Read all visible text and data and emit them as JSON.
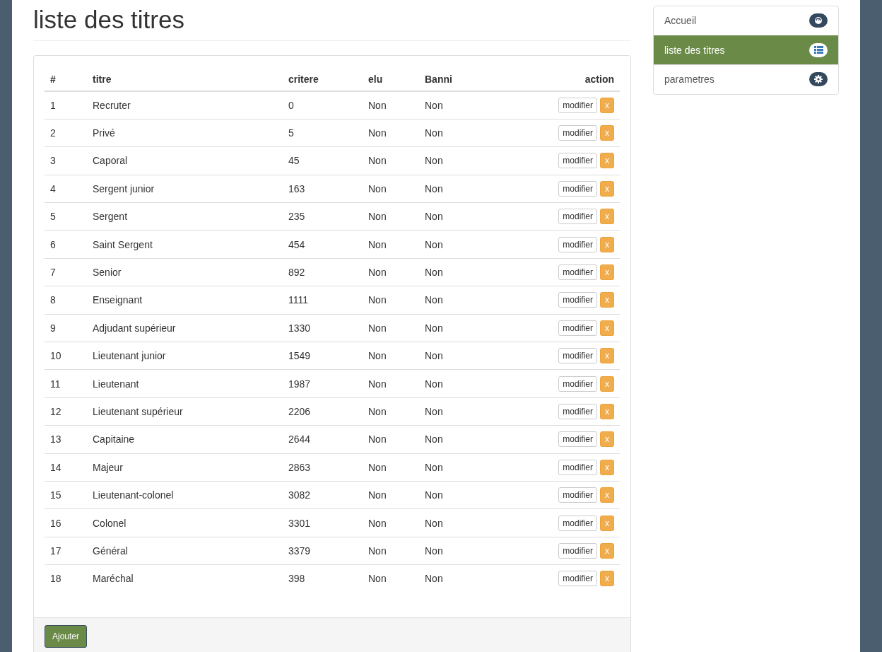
{
  "page_title": "liste des titres",
  "table": {
    "columns": [
      "#",
      "titre",
      "critere",
      "elu",
      "Banni",
      "action"
    ],
    "rows": [
      {
        "cells": [
          "1",
          "Recruter",
          "0",
          "Non",
          "Non"
        ],
        "edit": "modifier",
        "delete": "x"
      },
      {
        "cells": [
          "2",
          "Privé",
          "5",
          "Non",
          "Non"
        ],
        "edit": "modifier",
        "delete": "x"
      },
      {
        "cells": [
          "3",
          "Caporal",
          "45",
          "Non",
          "Non"
        ],
        "edit": "modifier",
        "delete": "x"
      },
      {
        "cells": [
          "4",
          "Sergent junior",
          "163",
          "Non",
          "Non"
        ],
        "edit": "modifier",
        "delete": "x"
      },
      {
        "cells": [
          "5",
          "Sergent",
          "235",
          "Non",
          "Non"
        ],
        "edit": "modifier",
        "delete": "x"
      },
      {
        "cells": [
          "6",
          "Saint Sergent",
          "454",
          "Non",
          "Non"
        ],
        "edit": "modifier",
        "delete": "x"
      },
      {
        "cells": [
          "7",
          "Senior",
          "892",
          "Non",
          "Non"
        ],
        "edit": "modifier",
        "delete": "x"
      },
      {
        "cells": [
          "8",
          "Enseignant",
          "1111",
          "Non",
          "Non"
        ],
        "edit": "modifier",
        "delete": "x"
      },
      {
        "cells": [
          "9",
          "Adjudant supérieur",
          "1330",
          "Non",
          "Non"
        ],
        "edit": "modifier",
        "delete": "x"
      },
      {
        "cells": [
          "10",
          "Lieutenant junior",
          "1549",
          "Non",
          "Non"
        ],
        "edit": "modifier",
        "delete": "x"
      },
      {
        "cells": [
          "11",
          "Lieutenant",
          "1987",
          "Non",
          "Non"
        ],
        "edit": "modifier",
        "delete": "x"
      },
      {
        "cells": [
          "12",
          "Lieutenant supérieur",
          "2206",
          "Non",
          "Non"
        ],
        "edit": "modifier",
        "delete": "x"
      },
      {
        "cells": [
          "13",
          "Capitaine",
          "2644",
          "Non",
          "Non"
        ],
        "edit": "modifier",
        "delete": "x"
      },
      {
        "cells": [
          "14",
          "Majeur",
          "2863",
          "Non",
          "Non"
        ],
        "edit": "modifier",
        "delete": "x"
      },
      {
        "cells": [
          "15",
          "Lieutenant-colonel",
          "3082",
          "Non",
          "Non"
        ],
        "edit": "modifier",
        "delete": "x"
      },
      {
        "cells": [
          "16",
          "Colonel",
          "3301",
          "Non",
          "Non"
        ],
        "edit": "modifier",
        "delete": "x"
      },
      {
        "cells": [
          "17",
          "Général",
          "3379",
          "Non",
          "Non"
        ],
        "edit": "modifier",
        "delete": "x"
      },
      {
        "cells": [
          "18",
          "Maréchal",
          "398",
          "Non",
          "Non"
        ],
        "edit": "modifier",
        "delete": "x"
      }
    ]
  },
  "add_button": "Ajouter",
  "sidebar": {
    "items": [
      {
        "label": "Accueil",
        "selected": false
      },
      {
        "label": "liste des titres",
        "selected": true
      },
      {
        "label": "parametres",
        "selected": false
      }
    ]
  }
}
